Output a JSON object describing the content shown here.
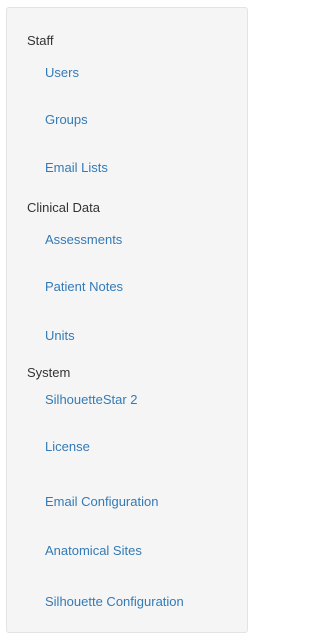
{
  "sidebar": {
    "sections": [
      {
        "title": "Staff",
        "items": [
          "Users",
          "Groups",
          "Email Lists"
        ]
      },
      {
        "title": "Clinical Data",
        "items": [
          "Assessments",
          "Patient Notes",
          "Units"
        ]
      },
      {
        "title": "System",
        "items": [
          "SilhouetteStar 2",
          "License",
          "Email Configuration",
          "Anatomical Sites",
          "Silhouette Configuration"
        ]
      }
    ]
  },
  "colors": {
    "panel_background": "#f5f5f5",
    "panel_border": "#e3e3e3",
    "section_text": "#333333",
    "link_text": "#337ab7"
  }
}
